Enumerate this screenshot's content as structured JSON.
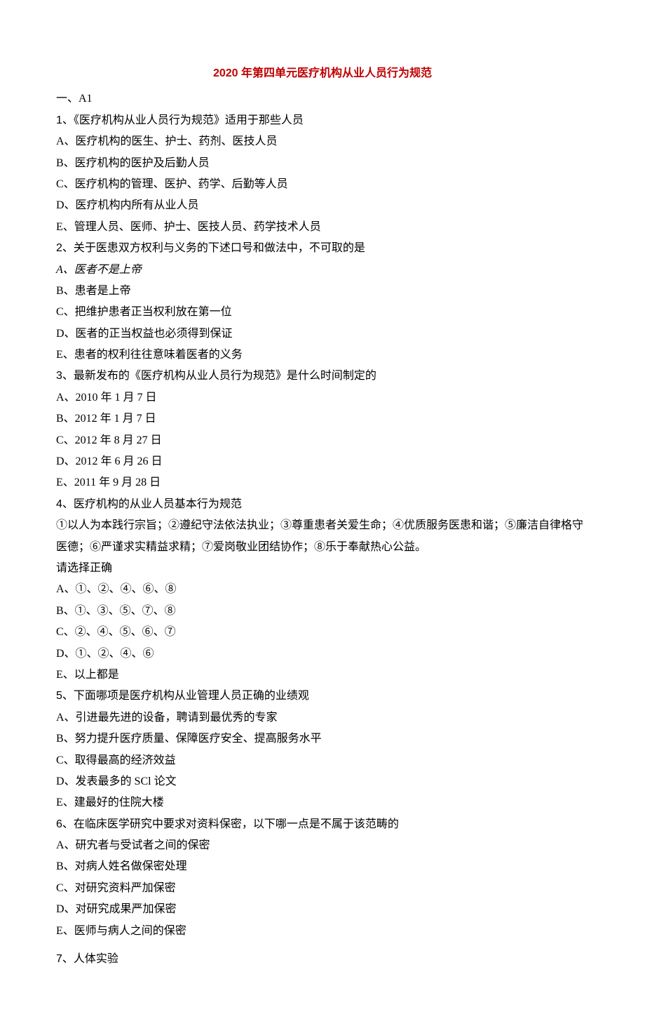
{
  "title": "2020 年第四单元医疗机构从业人员行为规范",
  "section": "一、A1",
  "q1": {
    "stem": "1、《医疗机构从业人员行为规范》适用于那些人员",
    "a": "A、医疗机构的医生、护士、药剂、医技人员",
    "b": "B、医疗机构的医护及后勤人员",
    "c": "C、医疗机构的管理、医护、药学、后勤等人员",
    "d": "D、医疗机构内所有从业人员",
    "e": "E、管理人员、医师、护士、医技人员、药学技术人员"
  },
  "q2": {
    "stem": "2、关于医患双方权利与义务的下述口号和做法中，不可取的是",
    "a": "A、医者不是上帝",
    "b": "B、患者是上帝",
    "c": "C、把维护患者正当权利放在第一位",
    "d": "D、医者的正当权益也必须得到保证",
    "e": "E、患者的权利往往意味着医者的义务"
  },
  "q3": {
    "stem": "3、最新发布的《医疗机构从业人员行为规范》是什么时间制定的",
    "a": "A、2010 年 1 月 7 日",
    "b": "B、2012 年 1 月 7 日",
    "c": "C、2012 年 8 月 27 日",
    "d": "D、2012 年 6 月 26 日",
    "e": "E、2011 年 9 月 28 日"
  },
  "q4": {
    "stem": "4、医疗机构的从业人员基本行为规范",
    "desc": "①以人为本践行宗旨；②遵纪守法依法执业；③尊重患者关爱生命；④优质服务医患和谐；⑤廉洁自律格守医德；⑥严谨求实精益求精；⑦爱岗敬业团结协作；⑧乐于奉献热心公益。",
    "prompt": "请选择正确",
    "a": "A、①、②、④、⑥、⑧",
    "b": "B、①、③、⑤、⑦、⑧",
    "c": "C、②、④、⑤、⑥、⑦",
    "d": "D、①、②、④、⑥",
    "e": "E、以上都是"
  },
  "q5": {
    "stem": "5、下面哪项是医疗机构从业管理人员正确的业绩观",
    "a": "A、引进最先进的设备，聘请到最优秀的专家",
    "b": "B、努力提升医疗质量、保障医疗安全、提高服务水平",
    "c": "C、取得最高的经济效益",
    "d": "D、发表最多的 SCl 论文",
    "e": "E、建最好的住院大楼"
  },
  "q6": {
    "stem": "6、在临床医学研究中要求对资料保密，以下哪一点是不属于该范畴的",
    "a": "A、研宄者与受试者之间的保密",
    "b": "B、对病人姓名做保密处理",
    "c": "C、对研究资料严加保密",
    "d": "D、对研究成果严加保密",
    "e": "E、医师与病人之间的保密"
  },
  "q7": {
    "stem": "7、人体实验"
  }
}
